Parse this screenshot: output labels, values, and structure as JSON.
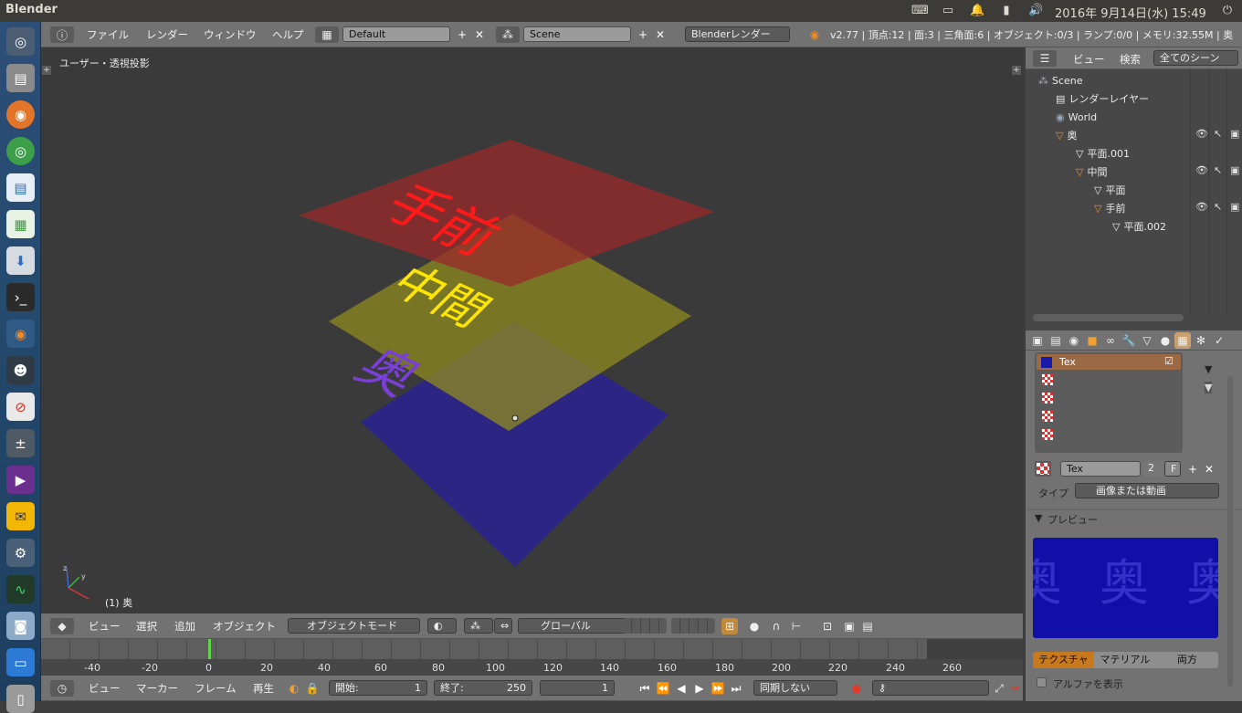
{
  "topbar": {
    "app_title": "Blender",
    "clock": "2016年 9月14日(水) 15:49"
  },
  "info_header": {
    "menus": [
      "ファイル",
      "レンダー",
      "ウィンドウ",
      "ヘルプ"
    ],
    "screen_layout": "Default",
    "scene": "Scene",
    "render_engine": "Blenderレンダー",
    "stats": "v2.77 | 頂点:12 | 面:3 | 三角面:6 | オブジェクト:0/3 | ランプ:0/0 | メモリ:32.55M | 奥"
  },
  "viewport": {
    "view_label": "ユーザー・透視投影",
    "object_label": "(1) 奥",
    "planes": [
      {
        "name": "手前",
        "text": "手前",
        "fill": "#8b2a2a",
        "text_color": "#ff1a1a"
      },
      {
        "name": "中間",
        "text": "中間",
        "fill": "#7d7a1c",
        "text_color": "#ffe600"
      },
      {
        "name": "奥",
        "text": "奥",
        "fill": "#2c2488",
        "text_color": "#7a3fd6"
      }
    ]
  },
  "view3d_header": {
    "menus": [
      "ビュー",
      "選択",
      "追加",
      "オブジェクト"
    ],
    "mode": "オブジェクトモード",
    "orientation": "グローバル"
  },
  "timeline": {
    "ticks": [
      "-40",
      "-20",
      "0",
      "20",
      "40",
      "60",
      "80",
      "100",
      "120",
      "140",
      "160",
      "180",
      "200",
      "220",
      "240",
      "260"
    ],
    "menus": [
      "ビュー",
      "マーカー",
      "フレーム",
      "再生"
    ],
    "start_label": "開始:",
    "start_value": "1",
    "end_label": "終了:",
    "end_value": "250",
    "current_frame": "1",
    "sync": "同期しない"
  },
  "outliner": {
    "tabs": [
      "ビュー",
      "検索",
      "全てのシーン"
    ],
    "rows": [
      {
        "label": "Scene",
        "indent": 0
      },
      {
        "label": "レンダーレイヤー",
        "indent": 1
      },
      {
        "label": "World",
        "indent": 1
      },
      {
        "label": "奥",
        "indent": 1
      },
      {
        "label": "平面.001",
        "indent": 2
      },
      {
        "label": "中間",
        "indent": 2
      },
      {
        "label": "平面",
        "indent": 3
      },
      {
        "label": "手前",
        "indent": 3
      },
      {
        "label": "平面.002",
        "indent": 4
      }
    ]
  },
  "properties": {
    "texture_slot": "Tex",
    "texture_name": "Tex",
    "users": "2",
    "fake_user": "F",
    "type_label": "タイプ",
    "type_value": "画像または動画",
    "preview_label": "プレビュー",
    "preview_text": "奥",
    "preview_tabs": [
      "テクスチャ",
      "マテリアル",
      "両方"
    ],
    "show_alpha": "アルファを表示"
  }
}
